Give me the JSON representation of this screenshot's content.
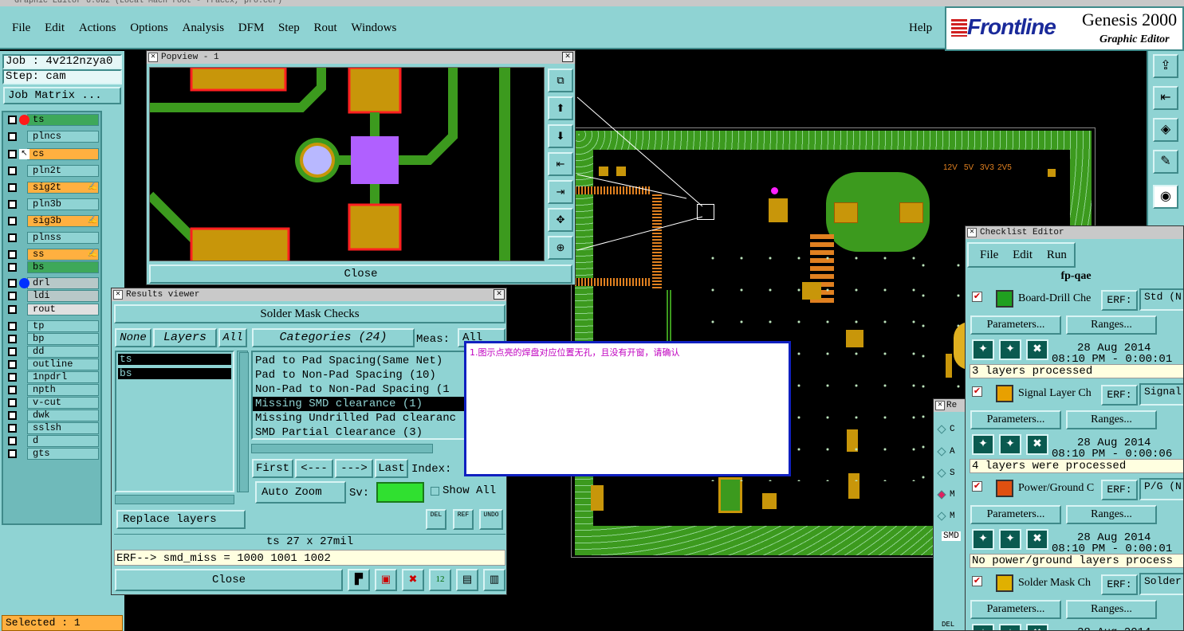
{
  "app": {
    "title": "Graphic Editor 6.0b2 (Local Mach root - fraccx, pro.cer)",
    "brand": "Frontline",
    "product": "Genesis 2000",
    "subtitle": "Graphic Editor"
  },
  "menu": {
    "items": [
      "File",
      "Edit",
      "Actions",
      "Options",
      "Analysis",
      "DFM",
      "Step",
      "Rout",
      "Windows"
    ],
    "help": "Help"
  },
  "job": {
    "job_label": "Job : 4v212nzya0",
    "step_label": "Step: cam",
    "matrix_button": "Job Matrix ..."
  },
  "layers": [
    {
      "name": "ts",
      "color": "#3ea85a",
      "dot": "#ff1a1a"
    },
    {
      "name": "plncs",
      "color": "#8fd3d3"
    },
    {
      "name": "cs",
      "color": "#ffb040",
      "icon": "cursor"
    },
    {
      "name": "pln2t",
      "color": "#8fd3d3"
    },
    {
      "name": "sig2t",
      "color": "#ffb040",
      "flag": "✍"
    },
    {
      "name": "pln3b",
      "color": "#8fd3d3"
    },
    {
      "name": "sig3b",
      "color": "#ffb040",
      "flag": "✍"
    },
    {
      "name": "plnss",
      "color": "#8fd3d3"
    },
    {
      "name": "ss",
      "color": "#ffb040",
      "flag": "✍"
    },
    {
      "name": "bs",
      "color": "#3ea85a"
    },
    {
      "name": "drl",
      "color": "#b8c8c8",
      "dot": "#0030ff"
    },
    {
      "name": "ldi",
      "color": "#b8c8c8"
    },
    {
      "name": "rout",
      "color": "#e0e0e0"
    },
    {
      "name": "tp",
      "color": "#8fd3d3"
    },
    {
      "name": "bp",
      "color": "#8fd3d3"
    },
    {
      "name": "dd",
      "color": "#8fd3d3"
    },
    {
      "name": "outline",
      "color": "#8fd3d3"
    },
    {
      "name": "1npdrl",
      "color": "#8fd3d3"
    },
    {
      "name": "npth",
      "color": "#8fd3d3"
    },
    {
      "name": "v-cut",
      "color": "#8fd3d3"
    },
    {
      "name": "dwk",
      "color": "#8fd3d3"
    },
    {
      "name": "sslsh",
      "color": "#8fd3d3"
    },
    {
      "name": "d",
      "color": "#8fd3d3"
    },
    {
      "name": "gts",
      "color": "#8fd3d3"
    }
  ],
  "status": {
    "selected": "Selected : 1"
  },
  "popview": {
    "title": "Popview - 1",
    "close": "Close"
  },
  "results": {
    "title": "Results viewer",
    "header": "Solder Mask Checks",
    "none": "None",
    "layers": "Layers",
    "all": "All",
    "layer_list": [
      "ts",
      "bs"
    ],
    "categories": "Categories (24)",
    "meas_label": "Meas:",
    "meas_value": "All",
    "category_items": [
      "Pad to Pad Spacing(Same Net)",
      "Pad to Non-Pad Spacing (10)",
      "Non-Pad to Non-Pad Spacing (1",
      "Missing SMD clearance (1)",
      "Missing Undrilled Pad clearanc",
      "SMD Partial Clearance (3)"
    ],
    "selected_index": 3,
    "first": "First",
    "prev": "<---",
    "next": "--->",
    "last": "Last",
    "index_label": "Index:",
    "auto_zoom": "Auto Zoom",
    "sv_label": "Sv:",
    "show_all": "Show All",
    "replace_layers": "Replace layers",
    "size_info": "ts 27 x 27mil",
    "erf_text": "ERF--> smd_miss = 1000 1001 1002",
    "close": "Close",
    "del": "DEL",
    "ref": "REF",
    "undo": "UNDO"
  },
  "note": {
    "text": "1.图示点亮的焊盘对应位置无孔，且没有开窗，请确认"
  },
  "board": {
    "labels": [
      "12V",
      "5V",
      "3V3",
      "2V5"
    ]
  },
  "checklist": {
    "title": "Checklist Editor",
    "menu": [
      "File",
      "Edit",
      "Run"
    ],
    "name": "fp-qae",
    "items": [
      {
        "name": "Board-Drill Che",
        "erf": "ERF:",
        "erf_value": "Std (N",
        "params": "Parameters...",
        "ranges": "Ranges...",
        "date": "28 Aug 2014",
        "time": "08:10 PM - 0:00:01",
        "status": "3 layers processed"
      },
      {
        "name": "Signal Layer Ch",
        "erf": "ERF:",
        "erf_value": "Signal",
        "params": "Parameters...",
        "ranges": "Ranges...",
        "date": "28 Aug 2014",
        "time": "08:10 PM - 0:00:06",
        "status": "4 layers were processed"
      },
      {
        "name": "Power/Ground C",
        "erf": "ERF:",
        "erf_value": "P/G (N",
        "params": "Parameters...",
        "ranges": "Ranges...",
        "date": "28 Aug 2014",
        "time": "08:10 PM - 0:00:01",
        "status": "No power/ground layers process"
      },
      {
        "name": "Solder Mask Ch",
        "erf": "ERF:",
        "erf_value": "Solder",
        "params": "Parameters...",
        "ranges": "Ranges...",
        "date": "28 Aug 2014",
        "time": "",
        "status": ""
      }
    ]
  },
  "rep": {
    "title": "Re",
    "items": [
      "C",
      "A",
      "S",
      "M",
      "M"
    ],
    "smd": "SMD",
    "del": "DEL"
  },
  "colors": {
    "panel": "#8fd3d3",
    "board_green": "#3c9a1e",
    "pad": "#c8960a",
    "trace": "#3c9a1e",
    "highlight": "#b060ff"
  }
}
